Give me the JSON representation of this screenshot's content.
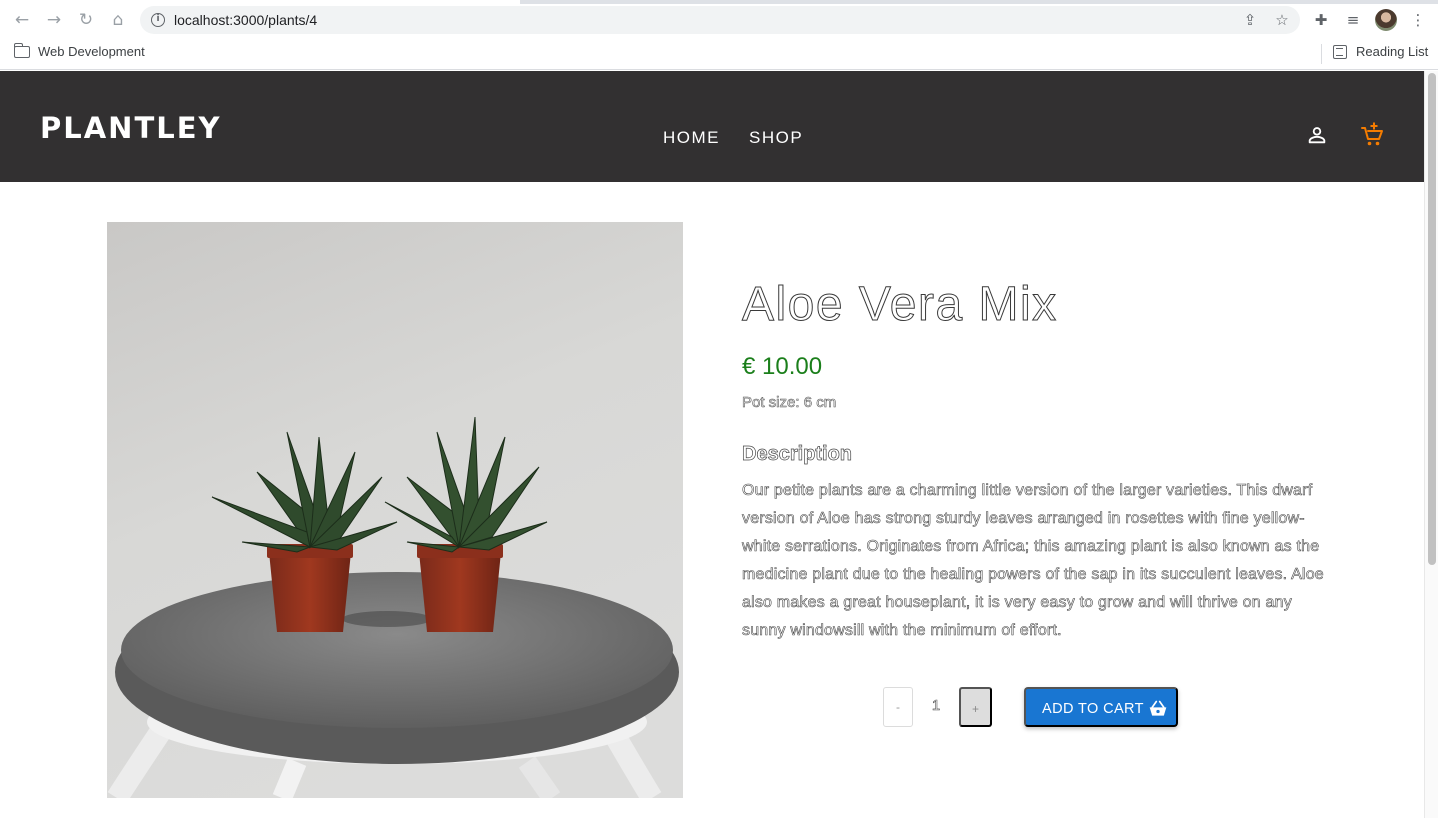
{
  "browser": {
    "url": "localhost:3000/plants/4",
    "bookmark_folder": "Web Development",
    "reading_list": "Reading List"
  },
  "site": {
    "logo": "PLANTLEY",
    "nav": [
      "HOME",
      "SHOP"
    ],
    "accent_cart_color": "#f57c00",
    "header_bg": "#323031"
  },
  "product": {
    "title": "Aloe Vera Mix",
    "price": "€ 10.00",
    "pot_size": "Pot size: 6 cm",
    "description_heading": "Description",
    "description": "Our petite plants are a charming little version of the larger varieties. This dwarf version of Aloe has strong sturdy leaves arranged in rosettes with fine yellow-white serrations. Originates from Africa; this amazing plant is also known as the medicine plant due to the healing powers of the sap in its succulent leaves. Aloe also makes a great houseplant, it is very easy to grow and will thrive on any sunny windowsill with the minimum of effort.",
    "quantity": "1",
    "minus_label": "-",
    "plus_label": "+",
    "add_to_cart": "ADD TO CART",
    "price_color": "#1b7f1b",
    "button_color": "#1976d2"
  }
}
